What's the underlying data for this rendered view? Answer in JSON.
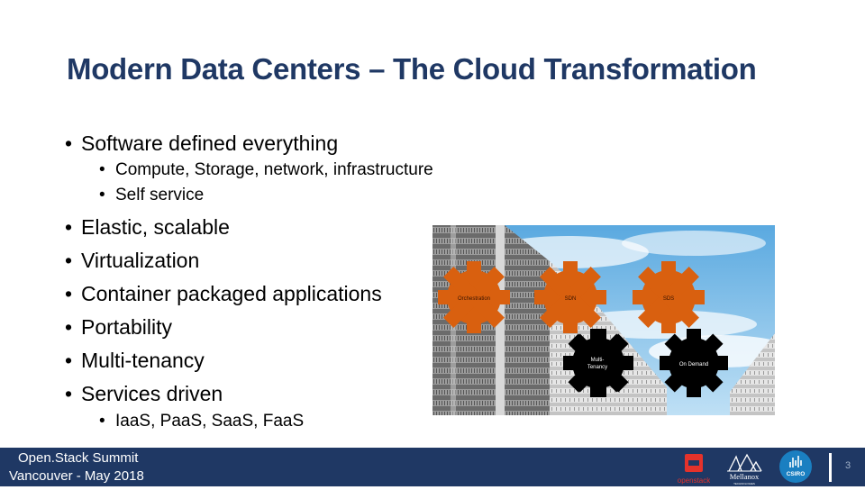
{
  "slide": {
    "title": "Modern Data Centers – The Cloud Transformation",
    "bullets": [
      {
        "level": 1,
        "text": "Software defined everything"
      },
      {
        "level": 2,
        "text": "Compute, Storage, network, infrastructure"
      },
      {
        "level": 2,
        "text": "Self service"
      },
      {
        "level": 1,
        "text": "Elastic, scalable"
      },
      {
        "level": 1,
        "text": "Virtualization"
      },
      {
        "level": 1,
        "text": "Container packaged applications"
      },
      {
        "level": 1,
        "text": "Portability"
      },
      {
        "level": 1,
        "text": "Multi-tenancy"
      },
      {
        "level": 1,
        "text": "Services driven"
      },
      {
        "level": 2,
        "text": "IaaS, PaaS, SaaS, FaaS"
      }
    ],
    "bullet_glyph": "•",
    "image": {
      "description": "data-center-gears",
      "gears": [
        {
          "label": "Orchestration",
          "color": "#d9600f"
        },
        {
          "label": "SDN",
          "color": "#d9600f"
        },
        {
          "label": "SDS",
          "color": "#d9600f"
        },
        {
          "label": "Multi-\nTenancy",
          "color": "#000000"
        },
        {
          "label": "On Demand",
          "color": "#000000"
        }
      ]
    }
  },
  "footer": {
    "line1": "Open.Stack Summit",
    "line2": "Vancouver - May 2018",
    "page_number": "3",
    "logos": {
      "openstack": "openstack",
      "mellanox": "Mellanox",
      "mellanox_sub": "TECHNOLOGIES",
      "csiro": "CSIRO"
    },
    "colors": {
      "bar": "#1f3864",
      "openstack_red": "#e4322b",
      "csiro_blue": "#1a7fc1"
    }
  }
}
